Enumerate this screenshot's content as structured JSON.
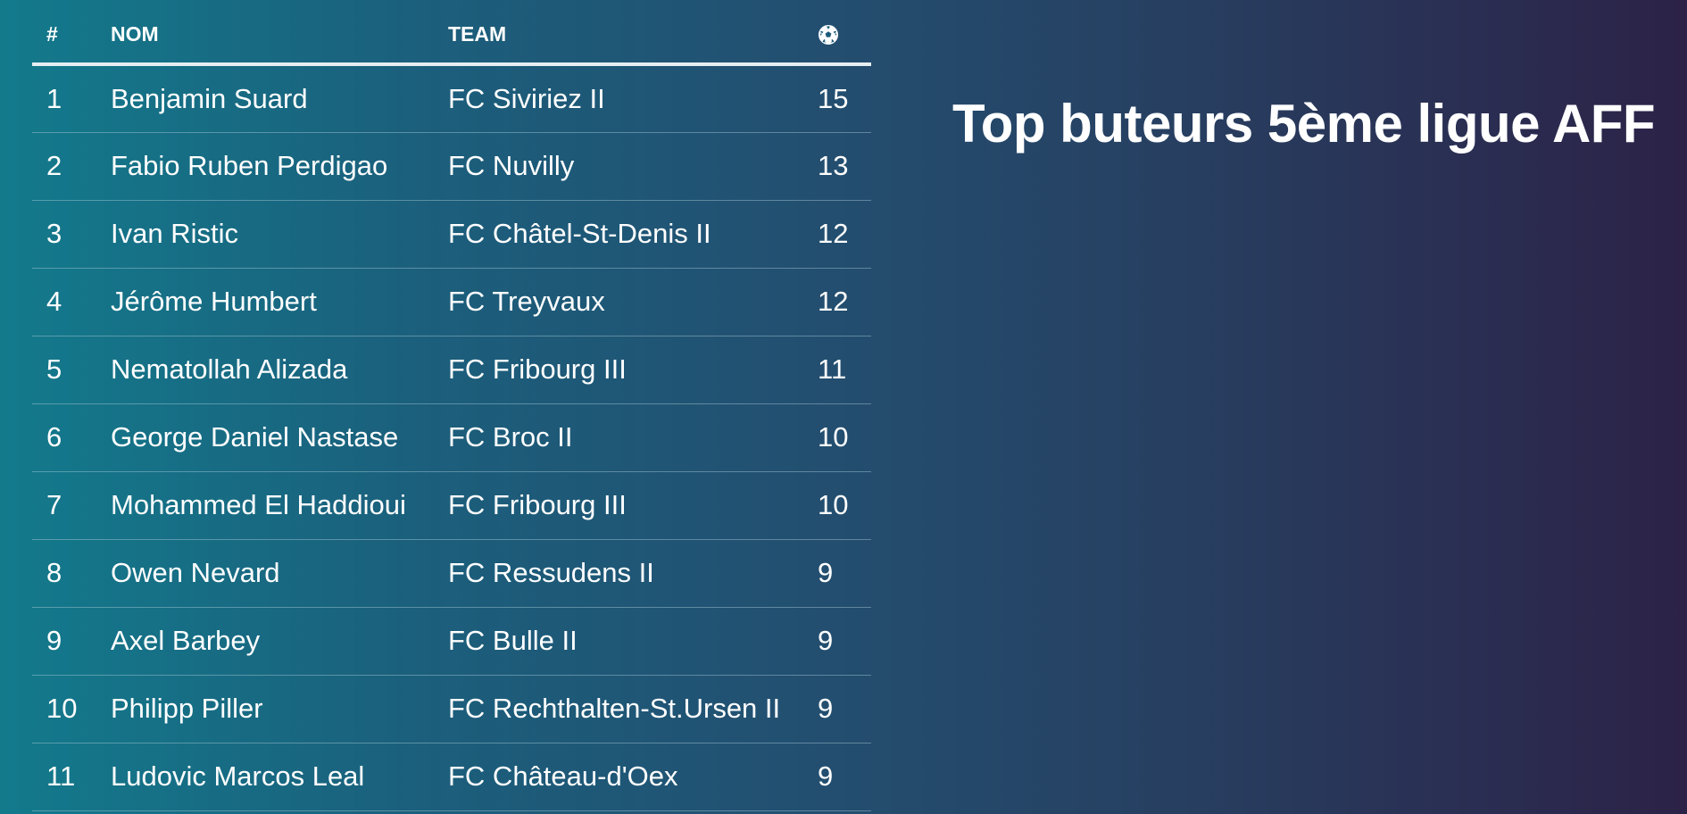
{
  "title": "Top buteurs 5ème ligue AFF",
  "table": {
    "headers": {
      "rank": "#",
      "name": "NOM",
      "team": "TEAM",
      "goals_icon": "soccer-ball-icon"
    },
    "rows": [
      {
        "rank": "1",
        "name": "Benjamin Suard",
        "team": "FC Siviriez II",
        "goals": "15"
      },
      {
        "rank": "2",
        "name": "Fabio Ruben Perdigao",
        "team": "FC Nuvilly",
        "goals": "13"
      },
      {
        "rank": "3",
        "name": "Ivan Ristic",
        "team": "FC Châtel-St-Denis II",
        "goals": "12"
      },
      {
        "rank": "4",
        "name": "Jérôme Humbert",
        "team": "FC Treyvaux",
        "goals": "12"
      },
      {
        "rank": "5",
        "name": "Nematollah Alizada",
        "team": "FC Fribourg III",
        "goals": "11"
      },
      {
        "rank": "6",
        "name": "George Daniel Nastase",
        "team": "FC Broc II",
        "goals": "10"
      },
      {
        "rank": "7",
        "name": "Mohammed El Haddioui",
        "team": "FC Fribourg III",
        "goals": "10"
      },
      {
        "rank": "8",
        "name": "Owen Nevard",
        "team": "FC Ressudens II",
        "goals": "9"
      },
      {
        "rank": "9",
        "name": "Axel Barbey",
        "team": "FC Bulle II",
        "goals": "9"
      },
      {
        "rank": "10",
        "name": "Philipp Piller",
        "team": "FC Rechthalten-St.Ursen II",
        "goals": "9"
      },
      {
        "rank": "11",
        "name": "Ludovic Marcos Leal",
        "team": "FC Château-d'Oex",
        "goals": "9"
      }
    ]
  },
  "colors": {
    "gradient_start": "#137a8c",
    "gradient_end": "#2c2247",
    "text": "#ffffff"
  }
}
